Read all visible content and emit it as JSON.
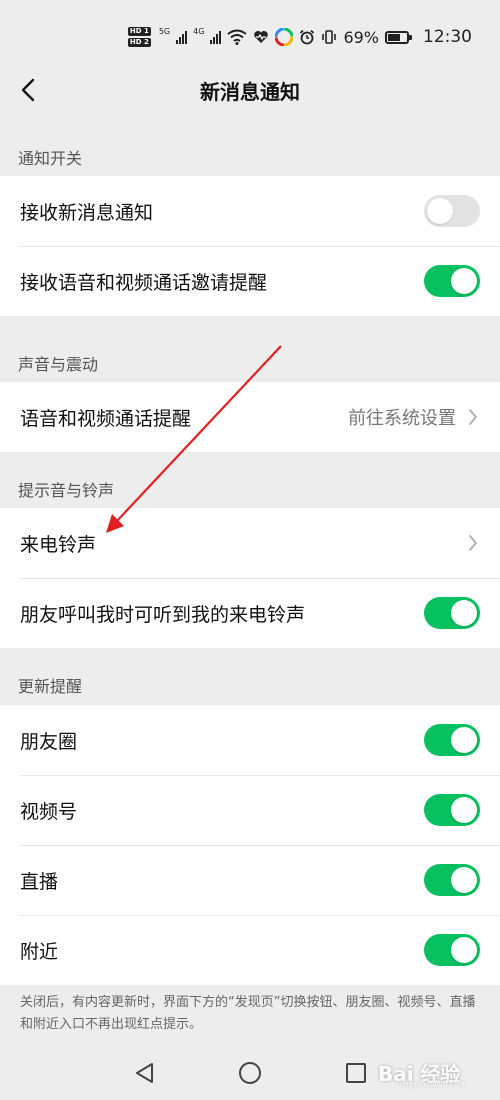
{
  "status_bar": {
    "hd1": "HD 1",
    "hd2": "HD 2",
    "net1": "5G",
    "net2": "4G",
    "battery_percent": "69%",
    "battery_level": 0.69,
    "time": "12:30"
  },
  "header": {
    "title": "新消息通知"
  },
  "sections": [
    {
      "title": "通知开关",
      "rows": [
        {
          "label": "接收新消息通知",
          "toggle": false
        },
        {
          "label": "接收语音和视频通话邀请提醒",
          "toggle": true
        }
      ]
    },
    {
      "title": "声音与震动",
      "rows": [
        {
          "label": "语音和视频通话提醒",
          "value": "前往系统设置"
        }
      ]
    },
    {
      "title": "提示音与铃声",
      "rows": [
        {
          "label": "来电铃声"
        },
        {
          "label": "朋友呼叫我时可听到我的来电铃声",
          "toggle": true
        }
      ]
    },
    {
      "title": "更新提醒",
      "rows": [
        {
          "label": "朋友圈",
          "toggle": true
        },
        {
          "label": "视频号",
          "toggle": true
        },
        {
          "label": "直播",
          "toggle": true
        },
        {
          "label": "附近",
          "toggle": true
        }
      ]
    }
  ],
  "footnote": "关闭后，有内容更新时，界面下方的“发现页”切换按钮、朋友圈、视频号、直播和附近入口不再出现红点提示。",
  "watermark": {
    "text": "Bai 经验",
    "sub": "jingyan.baidu.com"
  },
  "colors": {
    "background": "#ededed",
    "toggle_on": "#07c160",
    "toggle_off": "#e3e3e3",
    "annotation_arrow": "#e02020"
  }
}
